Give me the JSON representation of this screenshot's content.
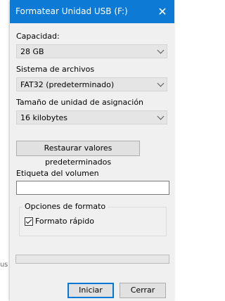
{
  "background_window": {
    "partial_text": "us"
  },
  "dialog": {
    "title": "Formatear Unidad USB (F:)",
    "capacity": {
      "label": "Capacidad:",
      "value": "28 GB"
    },
    "file_system": {
      "label": "Sistema de archivos",
      "value": "FAT32 (predeterminado)"
    },
    "allocation_unit": {
      "label": "Tamaño de unidad de asignación",
      "value": "16 kilobytes"
    },
    "restore_defaults_label": "Restaurar valores predeterminados",
    "volume_label": {
      "label": "Etiqueta del volumen",
      "value": ""
    },
    "format_options": {
      "legend": "Opciones de formato",
      "quick_format": {
        "label": "Formato rápido",
        "checked": true
      }
    },
    "progress": {
      "fraction": 0
    },
    "buttons": {
      "start": "Iniciar",
      "close": "Cerrar"
    }
  },
  "colors": {
    "titlebar": "#0d7bd6",
    "dialog_bg": "#f0f0f0",
    "primary_button_border": "#0078d7"
  }
}
